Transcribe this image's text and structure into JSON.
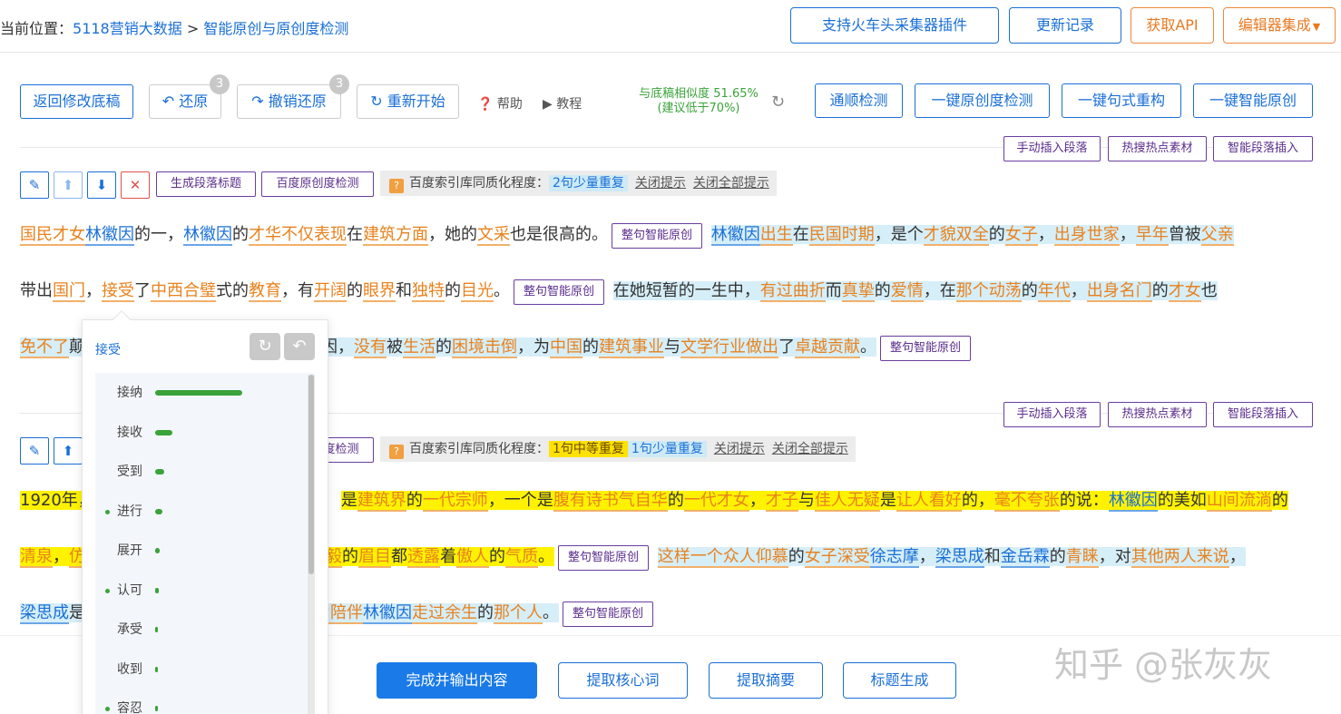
{
  "breadcrumb": {
    "prefix": "当前位置：",
    "site": "5118营销大数据",
    "sep": " > ",
    "page": "智能原创与原创度检测"
  },
  "top_buttons": {
    "plugin": "支持火车头采集器插件",
    "changelog": "更新记录",
    "api": "获取API",
    "editor": "编辑器集成"
  },
  "toolbar": {
    "back": "返回修改底稿",
    "undo": "还原",
    "undo_count": "3",
    "redo": "撤销还原",
    "redo_count": "3",
    "restart": "重新开始",
    "help": "帮助",
    "tutorial": "教程",
    "similarity": "与底稿相似度 51.65%",
    "similarity_hint": "(建议低于70%)",
    "fluency": "通顺检测",
    "originality": "一键原创度检测",
    "restructure": "一键句式重构",
    "smart": "一键智能原创"
  },
  "para_actions": {
    "insert": "手动插入段落",
    "hot": "热搜热点素材",
    "smart_insert": "智能段落插入"
  },
  "para1": {
    "gen_title": "生成段落标题",
    "baidu_check": "百度原创度检测",
    "info_label": "百度索引库同质化程度：",
    "info_low": "2句少量重复",
    "close_tip": "关闭提示",
    "close_all": "关闭全部提示",
    "rewrite": "整句智能原创"
  },
  "para2": {
    "baidu_check_tail": "度检测",
    "info_label": "百度索引库同质化程度：",
    "info_mid": "1句中等重复",
    "info_low": "1句少量重复",
    "close_tip": "关闭提示",
    "close_all": "关闭全部提示"
  },
  "popup": {
    "title": "接受",
    "items": [
      {
        "word": "接纳",
        "score": 1.0,
        "dot": false
      },
      {
        "word": "接收",
        "score": 0.2,
        "dot": false
      },
      {
        "word": "受到",
        "score": 0.1,
        "dot": false
      },
      {
        "word": "进行",
        "score": 0.08,
        "dot": true
      },
      {
        "word": "展开",
        "score": 0.05,
        "dot": false
      },
      {
        "word": "认可",
        "score": 0.04,
        "dot": true
      },
      {
        "word": "承受",
        "score": 0.03,
        "dot": false
      },
      {
        "word": "收到",
        "score": 0.02,
        "dot": false
      },
      {
        "word": "容忍",
        "score": 0.02,
        "dot": true
      }
    ]
  },
  "bottom": {
    "finish": "完成并输出内容",
    "keywords": "提取核心词",
    "summary": "提取摘要",
    "title_gen": "标题生成"
  },
  "watermark": "知乎 @张灰灰"
}
